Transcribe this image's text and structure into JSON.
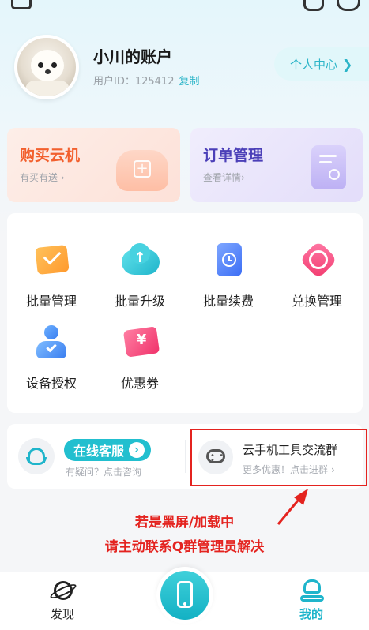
{
  "profile": {
    "name": "小川的账户",
    "uid_label": "用户ID：125412",
    "copy_label": "复制",
    "center_label": "个人中心",
    "center_chevron": "❯"
  },
  "cards": {
    "buy": {
      "title": "购买云机",
      "subtitle": "有买有送 ›"
    },
    "order": {
      "title": "订单管理",
      "subtitle": "查看详情›"
    }
  },
  "grid": {
    "items": [
      {
        "label": "批量管理",
        "icon": "batch-manage-icon"
      },
      {
        "label": "批量升级",
        "icon": "cloud-upload-icon"
      },
      {
        "label": "批量续费",
        "icon": "renew-clock-icon"
      },
      {
        "label": "兑换管理",
        "icon": "exchange-icon"
      },
      {
        "label": "设备授权",
        "icon": "device-auth-icon"
      },
      {
        "label": "优惠券",
        "icon": "coupon-icon"
      }
    ]
  },
  "service": {
    "online_label": "在线客服",
    "online_sub": "有疑问？点击咨询",
    "group_title": "云手机工具交流群",
    "group_sub": "更多优惠！点击进群 ›"
  },
  "notice": {
    "line1": "若是黑屏/加载中",
    "line2": "请主动联系Q群管理员解决",
    "color": "#e4231f"
  },
  "tabbar": {
    "discover": "发现",
    "mine": "我的",
    "accent": "#1fb5cb"
  }
}
